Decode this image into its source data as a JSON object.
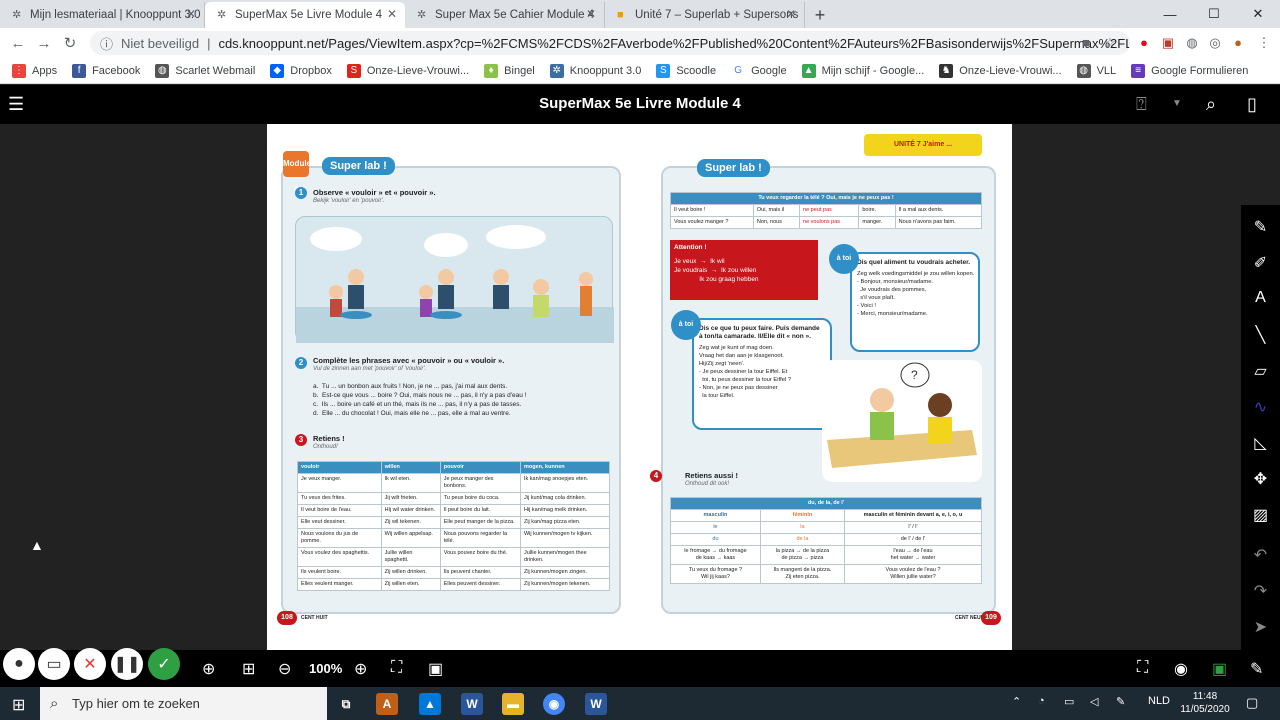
{
  "browser": {
    "tabs": [
      {
        "label": "Mijn lesmateriaal | Knooppunt 3.0",
        "icon": "knooppunt-icon"
      },
      {
        "label": "SuperMax 5e Livre Module 4",
        "icon": "knooppunt-icon"
      },
      {
        "label": "Super Max 5e Cahier Module 4",
        "icon": "knooppunt-icon"
      },
      {
        "label": "Unité 7 – Superlab + Supersons",
        "icon": "google-slides-icon"
      }
    ],
    "security": "Niet beveiligd",
    "url": "cds.knooppunt.net/Pages/ViewItem.aspx?cp=%2FCMS%2FCDS%2FAverbode%2FPublished%20Content%2FAuteurs%2FBasisonderwijs%2FSupermax%2FLivres%2FLivr...",
    "bookmarks": [
      "Apps",
      "Facebook",
      "Scarlet Webmail",
      "Dropbox",
      "Onze-Lieve-Vrouwi...",
      "Bingel",
      "Knooppunt 3.0",
      "Scoodle",
      "Google",
      "Mijn schijf - Google...",
      "Onze-Lieve-Vrouwi...",
      "VLL",
      "Google Formulieren"
    ]
  },
  "app": {
    "title": "SuperMax 5e Livre Module 4",
    "zoom": "100%"
  },
  "book": {
    "left": {
      "module": "Module 4",
      "superlab": "Super lab !",
      "ex1_title": "Observe « vouloir » et « pouvoir ».",
      "ex1_sub": "Bekijk 'vouloir' en 'pouvoir'.",
      "ex2_title": "Complète les phrases avec « pouvoir » ou « vouloir ».",
      "ex2_sub": "Vul de zinnen aan met 'pouvoir' of 'vouloir'.",
      "ex2_lines": [
        "a.  Tu ... un bonbon aux fruits ! Non, je ne ... pas, j'ai mal aux dents.",
        "b.  Est-ce que vous ... boire ? Oui, mais nous ne ... pas, il n'y a pas d'eau !",
        "c.  Ils ... boire un café et un thé, mais ils ne ... pas, il n'y a pas de tasses.",
        "d.  Elle ... du chocolat ! Oui, mais elle ne ... pas, elle a mal au ventre."
      ],
      "ex3_title": "Retiens !",
      "ex3_sub": "Onthoud!",
      "table_headers": [
        "vouloir",
        "willen",
        "pouvoir",
        "mogen, kunnen"
      ],
      "table_rows": [
        [
          "Je veux manger.",
          "Ik wil eten.",
          "Je peux manger des bonbons.",
          "Ik kan/mag snoepjes eten."
        ],
        [
          "Tu veux des frites.",
          "Jij wilt frieten.",
          "Tu peux boire du coca.",
          "Jij kunt/mag cola drinken."
        ],
        [
          "Il veut boire de l'eau.",
          "Hij wil water drinken.",
          "Il peut boire du lait.",
          "Hij kan/mag melk drinken."
        ],
        [
          "Elle veut dessiner.",
          "Zij wil tekenen.",
          "Elle peut manger de la pizza.",
          "Zij kan/mag pizza eten."
        ],
        [
          "Nous voulons du jus de pomme.",
          "Wij willen appelsap.",
          "Nous pouvons regarder la télé.",
          "Wij kunnen/mogen tv kijken."
        ],
        [
          "Vous voulez des spaghettis.",
          "Jullie willen spaghetti.",
          "Vous pouvez boire du thé.",
          "Jullie kunnen/mogen thee drinken."
        ],
        [
          "Ils veulent boire.",
          "Zij willen drinken.",
          "Ils peuvent chanter.",
          "Zij kunnen/mogen zingen."
        ],
        [
          "Elles veulent manger.",
          "Zij willen eten.",
          "Elles peuvent dessiner.",
          "Zij kunnen/mogen tekenen."
        ]
      ],
      "page_num": "108",
      "page_word": "CENT HUIT"
    },
    "right": {
      "unit": "UNITÉ 7  J'aime ...",
      "superlab": "Super lab !",
      "top_header": "Tu veux regarder la télé ? Oui, mais je ne peux pas !",
      "top_rows": [
        [
          "Il veut boire !",
          "Oui, mais il",
          "ne peut pas",
          "boire.",
          "Il a mal aux dents."
        ],
        [
          "Vous voulez manger ?",
          "Non, nous",
          "ne voulons pas",
          "manger.",
          "Nous n'avons pas faim."
        ]
      ],
      "attention": "Attention !",
      "attention_lines": [
        "Je veux  →  Ik wil",
        "Je voudrais  →  Ik zou willen",
        "              Ik zou graag hebben"
      ],
      "toi1_title": "Dis quel aliment tu voudrais acheter.",
      "toi1_body": "Zeg welk voedingsmiddel je zou willen kopen.\n- Bonjour, monsieur/madame.\n  Je voudrais des pommes,\n  s'il vous plaît.\n- Voici !\n- Merci, monsieur/madame.",
      "toi2_title": "Dis ce que tu peux faire. Puis demande à ton/ta camarade. Il/Elle dit « non ».",
      "toi2_body": "Zeg wat je kunt of mag doen.\nVraag het dan aan je klasgenoot.\nHij/Zij zegt 'neen'.\n- Je peux dessiner la tour Eiffel. Et\n  toi, tu peux dessiner la tour Eiffel ?\n- Non, je ne peux pas dessiner\n  la tour Eiffel.",
      "ex4_title": "Retiens aussi !",
      "ex4_sub": "Onthoud dit ook!",
      "art_header": "du, de la, de l'",
      "art_cols": [
        "masculin",
        "féminin",
        "masculin et féminin devant a, e, i, o, u"
      ],
      "art_row1": [
        "le",
        "la",
        "l' / l'"
      ],
      "art_row2": [
        "du",
        "de la",
        "de l' / de l'"
      ],
      "art_row3": [
        "le fromage → du fromage\nde kaas → kaas",
        "la pizza → de la pizza\nde pizza → pizza",
        "l'eau → de l'eau\nhet water → water"
      ],
      "art_row4": [
        "Tu veux du fromage ?\nWil jij kaas?",
        "Ils mangent de la pizza.\nZij eten pizza.",
        "Vous voulez de l'eau ?\nWillen jullie water?"
      ],
      "page_num": "109",
      "page_word": "CENT NEUF"
    }
  },
  "taskbar": {
    "search": "Typ hier om te zoeken",
    "lang": "NLD",
    "time": "11:48",
    "date": "11/05/2020"
  }
}
